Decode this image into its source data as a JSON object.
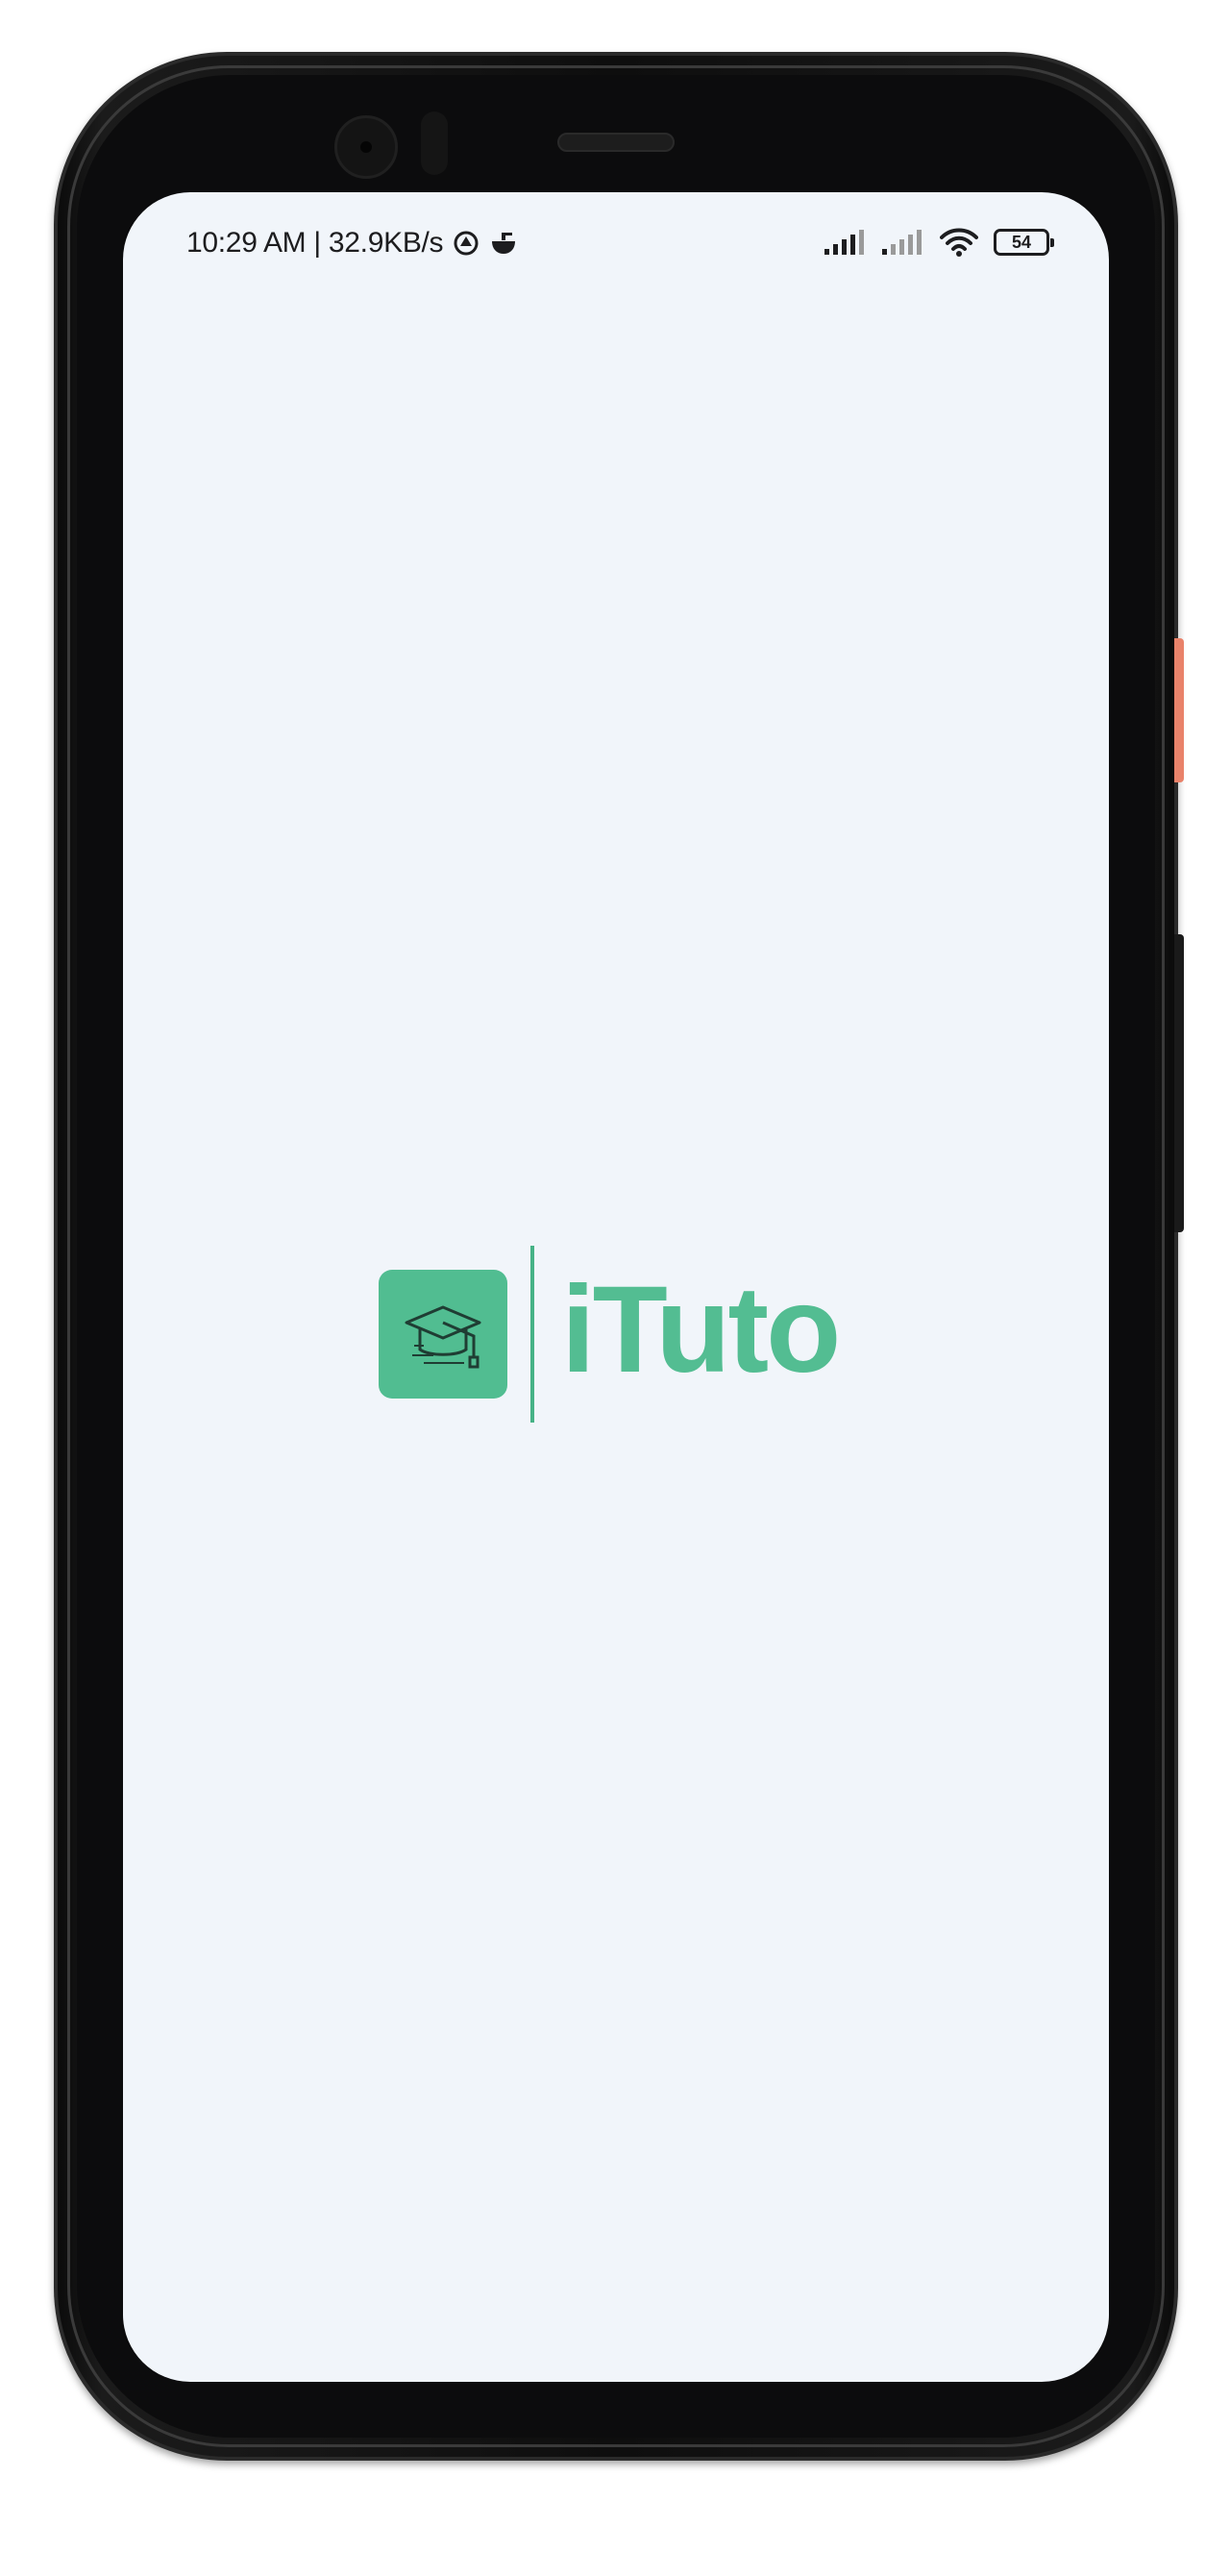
{
  "status_bar": {
    "time_and_speed": "10:29 AM | 32.9KB/s",
    "battery_level": "54",
    "icons": [
      "sync-icon",
      "app-notification-icon",
      "signal-icon-sim1",
      "signal-icon-sim2",
      "wifi-icon",
      "battery-icon"
    ]
  },
  "splash": {
    "app_name": "iTuto",
    "logo_icon": "graduation-cap-icon"
  },
  "colors": {
    "brand_green": "#53bd92",
    "screen_background": "#f1f5fa",
    "accent_button": "#e9826a"
  }
}
